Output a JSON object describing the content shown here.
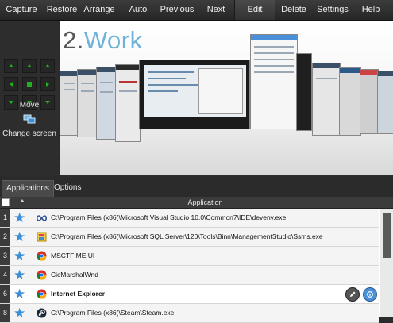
{
  "toolbar": {
    "capture": "Capture",
    "restore": "Restore",
    "arrange": "Arrange",
    "auto": "Auto",
    "previous": "Previous",
    "next": "Next",
    "edit": "Edit",
    "delete": "Delete",
    "settings": "Settings",
    "help": "Help"
  },
  "left_panel": {
    "move_label": "Move",
    "change_screen_label": "Change screen"
  },
  "workspace": {
    "number": "2.",
    "name": "Work"
  },
  "tabs": {
    "applications": "Applications",
    "options": "Options"
  },
  "table": {
    "header": "Application",
    "rows": [
      {
        "num": "1",
        "text": "C:\\Program Files (x86)\\Microsoft Visual Studio 10.0\\Common7\\IDE\\devenv.exe",
        "icon": "infinity-icon"
      },
      {
        "num": "2",
        "text": "C:\\Program Files (x86)\\Microsoft SQL Server\\120\\Tools\\Binn\\ManagementStudio\\Ssms.exe",
        "icon": "ssms-icon"
      },
      {
        "num": "3",
        "text": "MSCTFIME UI",
        "icon": "chrome-icon"
      },
      {
        "num": "4",
        "text": "CicMarshalWnd",
        "icon": "chrome-icon"
      },
      {
        "num": "6",
        "text": "Internet Explorer",
        "icon": "chrome-icon"
      },
      {
        "num": "8",
        "text": "C:\\Program Files (x86)\\Steam\\Steam.exe",
        "icon": "steam-icon"
      }
    ]
  },
  "colors": {
    "accent_blue": "#6fb3d8",
    "star_blue": "#3b8fd6",
    "dpad_green": "#22b022"
  }
}
